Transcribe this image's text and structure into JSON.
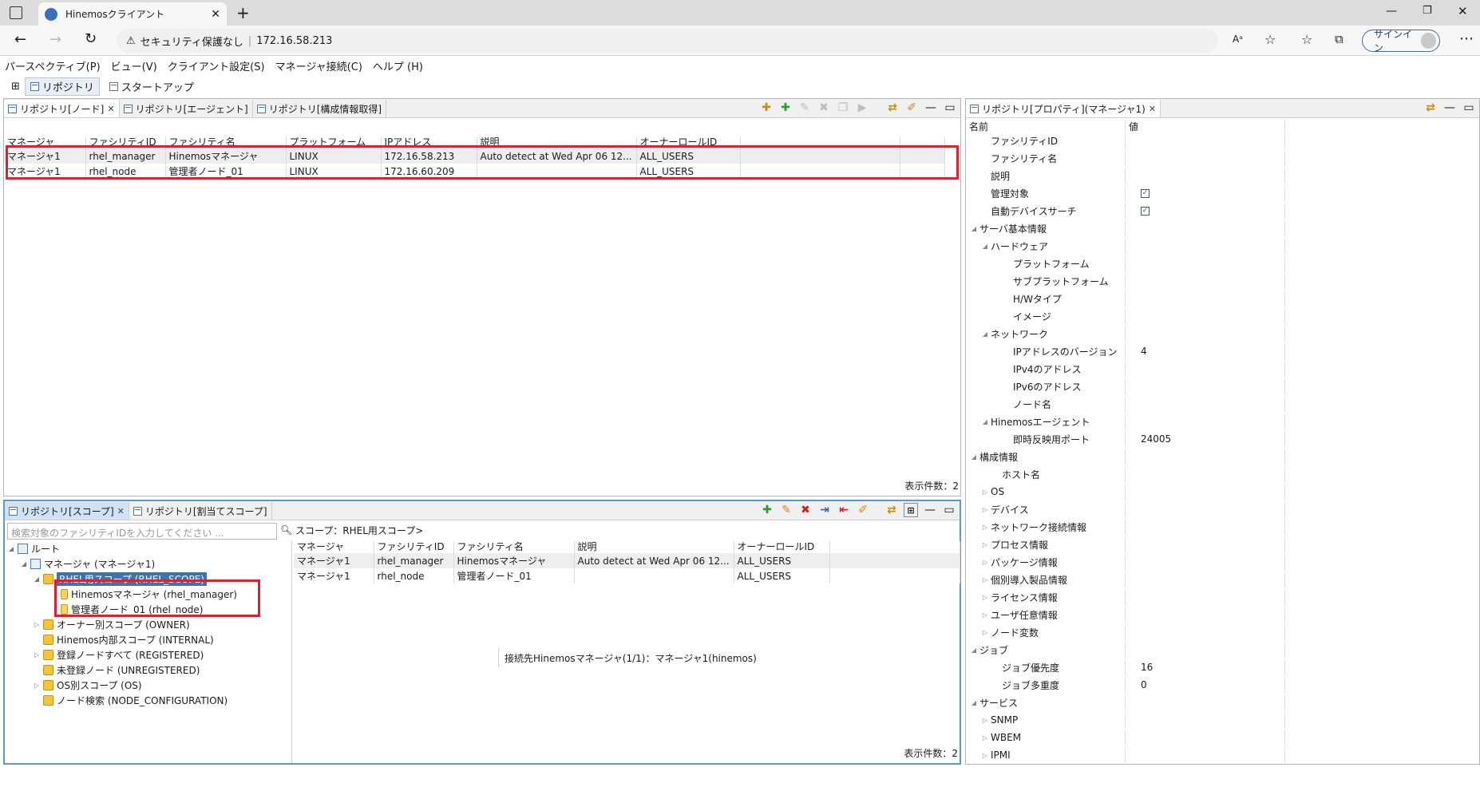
{
  "browser": {
    "tab_title": "Hinemosクライアント",
    "security_label": "セキュリティ保護なし",
    "url": "172.16.58.213",
    "signin_label": "サインイン",
    "read_aloud_label": "Aᵃ"
  },
  "menu": [
    "パースペクティブ(P)",
    "ビュー(V)",
    "クライアント設定(S)",
    "マネージャ接続(C)",
    "ヘルプ (H)"
  ],
  "perspectives": {
    "repository": "リポジトリ",
    "startup": "スタートアップ"
  },
  "node_view": {
    "tabs": [
      "リポジトリ[ノード]",
      "リポジトリ[エージェント]",
      "リポジトリ[構成情報取得]"
    ],
    "columns": [
      "マネージャ",
      "ファシリティID",
      "ファシリティ名",
      "プラットフォーム",
      "IPアドレス",
      "説明",
      "オーナーロールID"
    ],
    "rows": [
      [
        "マネージャ1",
        "rhel_manager",
        "Hinemosマネージャ",
        "LINUX",
        "172.16.58.213",
        "Auto detect at Wed Apr 06 12...",
        "ALL_USERS"
      ],
      [
        "マネージャ1",
        "rhel_node",
        "管理者ノード_01",
        "LINUX",
        "172.16.60.209",
        "",
        "ALL_USERS"
      ]
    ],
    "count_label": "表示件数：2"
  },
  "scope_view": {
    "tabs": [
      "リポジトリ[スコープ]",
      "リポジトリ[割当てスコープ]"
    ],
    "search_placeholder": "検索対象のファシリティIDを入力してください ...",
    "scope_path": "スコープ：RHEL用スコープ>",
    "tree": {
      "root": "ルート",
      "manager": "マネージャ (マネージャ1)",
      "rhel_scope": "RHEL用スコープ (RHEL_SCOPE)",
      "node_manager": "Hinemosマネージャ (rhel_manager)",
      "node_admin": "管理者ノード_01 (rhel_node)",
      "owner": "オーナー別スコープ (OWNER)",
      "internal": "Hinemos内部スコープ (INTERNAL)",
      "registered": "登録ノードすべて (REGISTERED)",
      "unregistered": "未登録ノード (UNREGISTERED)",
      "os": "OS別スコープ (OS)",
      "node_config": "ノード検索 (NODE_CONFIGURATION)"
    },
    "columns": [
      "マネージャ",
      "ファシリティID",
      "ファシリティ名",
      "説明",
      "オーナーロールID"
    ],
    "rows": [
      [
        "マネージャ1",
        "rhel_manager",
        "Hinemosマネージャ",
        "Auto detect at Wed Apr 06 12...",
        "ALL_USERS"
      ],
      [
        "マネージャ1",
        "rhel_node",
        "管理者ノード_01",
        "",
        "ALL_USERS"
      ]
    ],
    "count_label": "表示件数：2"
  },
  "property_view": {
    "tab": "リポジトリ[プロパティ](マネージャ1)",
    "col_name": "名前",
    "col_value": "値",
    "rows": [
      {
        "name": "ファシリティID",
        "value": "",
        "level": 1,
        "toggle": ""
      },
      {
        "name": "ファシリティ名",
        "value": "",
        "level": 1,
        "toggle": ""
      },
      {
        "name": "説明",
        "value": "",
        "level": 1,
        "toggle": ""
      },
      {
        "name": "管理対象",
        "value": "",
        "level": 1,
        "toggle": "",
        "checked": true
      },
      {
        "name": "自動デバイスサーチ",
        "value": "",
        "level": 1,
        "toggle": "",
        "checked": true
      },
      {
        "name": "サーバ基本情報",
        "value": "",
        "level": 0,
        "toggle": "◢"
      },
      {
        "name": "ハードウェア",
        "value": "",
        "level": 1,
        "toggle": "◢"
      },
      {
        "name": "プラットフォーム",
        "value": "",
        "level": 3,
        "toggle": ""
      },
      {
        "name": "サブプラットフォーム",
        "value": "",
        "level": 3,
        "toggle": ""
      },
      {
        "name": "H/Wタイプ",
        "value": "",
        "level": 3,
        "toggle": ""
      },
      {
        "name": "イメージ",
        "value": "",
        "level": 3,
        "toggle": ""
      },
      {
        "name": "ネットワーク",
        "value": "",
        "level": 1,
        "toggle": "◢"
      },
      {
        "name": "IPアドレスのバージョン",
        "value": "4",
        "level": 3,
        "toggle": ""
      },
      {
        "name": "IPv4のアドレス",
        "value": "",
        "level": 3,
        "toggle": ""
      },
      {
        "name": "IPv6のアドレス",
        "value": "",
        "level": 3,
        "toggle": ""
      },
      {
        "name": "ノード名",
        "value": "",
        "level": 3,
        "toggle": ""
      },
      {
        "name": "Hinemosエージェント",
        "value": "",
        "level": 1,
        "toggle": "◢"
      },
      {
        "name": "即時反映用ポート",
        "value": "24005",
        "level": 3,
        "toggle": ""
      },
      {
        "name": "構成情報",
        "value": "",
        "level": 0,
        "toggle": "◢"
      },
      {
        "name": "ホスト名",
        "value": "",
        "level": 2,
        "toggle": ""
      },
      {
        "name": "OS",
        "value": "",
        "level": 1,
        "toggle": "▷"
      },
      {
        "name": "デバイス",
        "value": "",
        "level": 1,
        "toggle": "▷"
      },
      {
        "name": "ネットワーク接続情報",
        "value": "",
        "level": 1,
        "toggle": "▷"
      },
      {
        "name": "プロセス情報",
        "value": "",
        "level": 1,
        "toggle": "▷"
      },
      {
        "name": "パッケージ情報",
        "value": "",
        "level": 1,
        "toggle": "▷"
      },
      {
        "name": "個別導入製品情報",
        "value": "",
        "level": 1,
        "toggle": "▷"
      },
      {
        "name": "ライセンス情報",
        "value": "",
        "level": 1,
        "toggle": "▷"
      },
      {
        "name": "ユーザ任意情報",
        "value": "",
        "level": 1,
        "toggle": "▷"
      },
      {
        "name": "ノード変数",
        "value": "",
        "level": 1,
        "toggle": "▷"
      },
      {
        "name": "ジョブ",
        "value": "",
        "level": 0,
        "toggle": "◢"
      },
      {
        "name": "ジョブ優先度",
        "value": "16",
        "level": 2,
        "toggle": ""
      },
      {
        "name": "ジョブ多重度",
        "value": "0",
        "level": 2,
        "toggle": ""
      },
      {
        "name": "サービス",
        "value": "",
        "level": 0,
        "toggle": "◢"
      },
      {
        "name": "SNMP",
        "value": "",
        "level": 1,
        "toggle": "▷"
      },
      {
        "name": "WBEM",
        "value": "",
        "level": 1,
        "toggle": "▷"
      },
      {
        "name": "IPMI",
        "value": "",
        "level": 1,
        "toggle": "▷"
      }
    ]
  },
  "status": {
    "connection": "接続先Hinemosマネージャ(1/1)：マネージャ1(hinemos)"
  },
  "colors": {
    "highlight_red": "#d9232e",
    "focus_blue": "#5c9bc9",
    "selection_blue": "#3a74b4"
  }
}
